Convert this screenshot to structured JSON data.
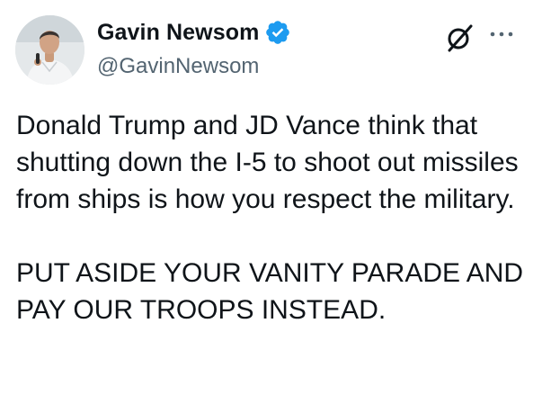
{
  "author": {
    "display_name": "Gavin Newsom",
    "handle": "@GavinNewsom",
    "verified": true,
    "verified_color": "#1d9bf0"
  },
  "icons": {
    "verified": "verified-badge-icon",
    "grok": "grok-icon",
    "more": "more-options-icon"
  },
  "tweet": {
    "paragraph_1": "Donald Trump and JD Vance think that shutting down the I-5 to shoot out missiles from ships is how you respect the military.",
    "paragraph_2": "PUT ASIDE YOUR VANITY PARADE AND PAY OUR TROOPS INSTEAD."
  },
  "colors": {
    "text": "#0f1419",
    "secondary": "#536471",
    "accent": "#1d9bf0",
    "background": "#ffffff"
  }
}
